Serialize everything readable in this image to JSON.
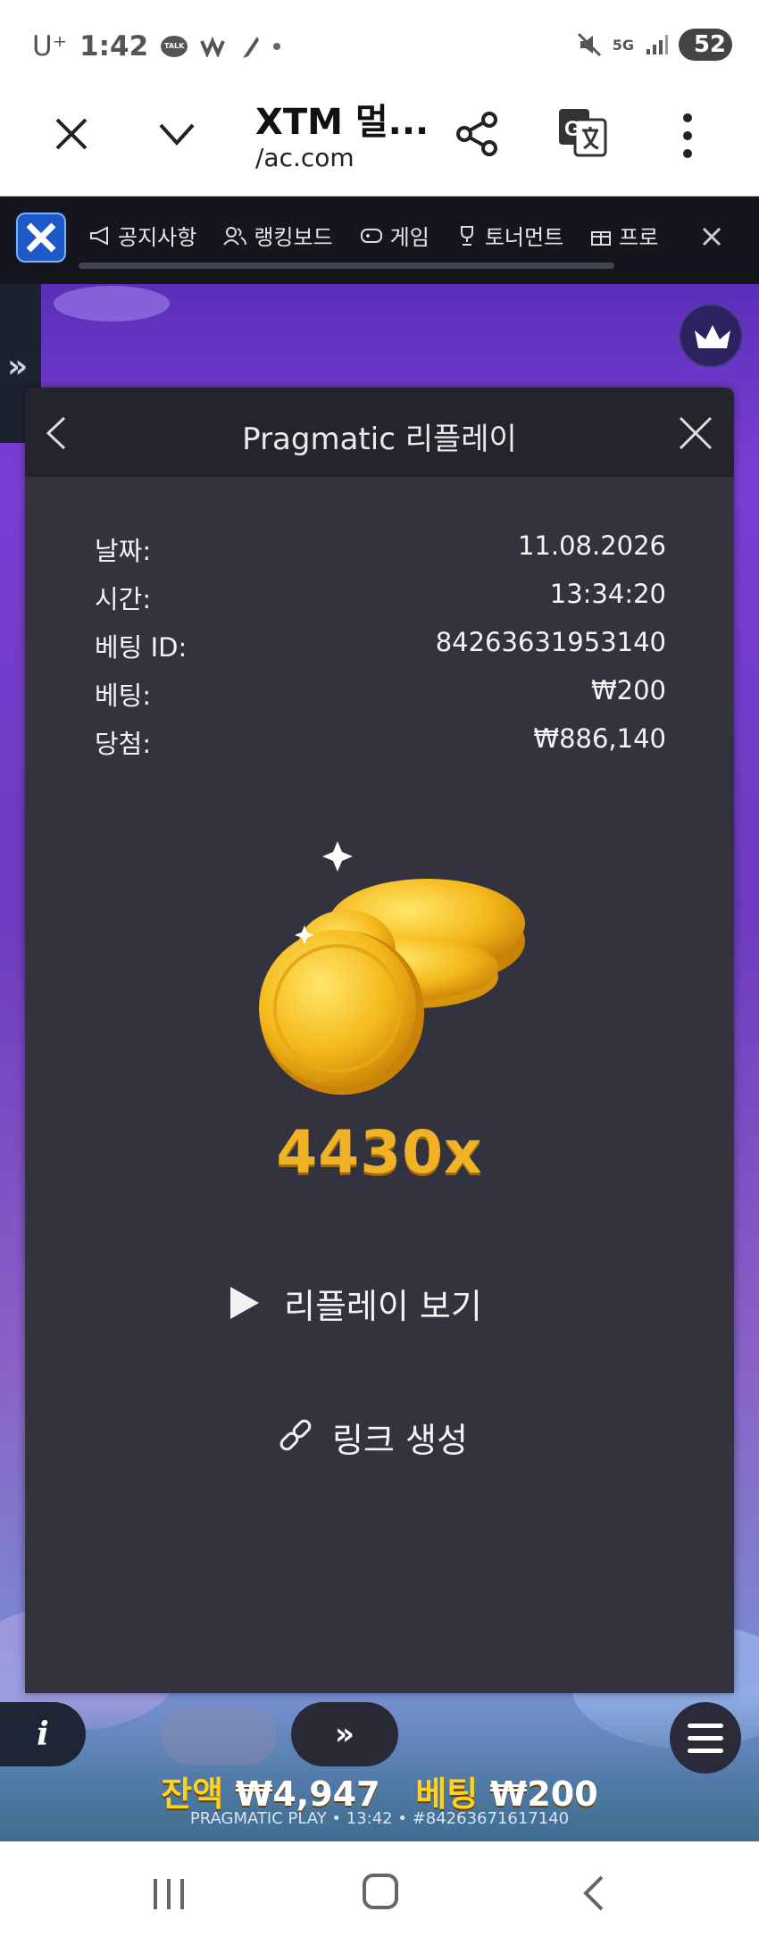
{
  "status_bar": {
    "carrier": "U⁺",
    "time": "1:42",
    "talk_badge": "TALK",
    "network": "5G",
    "battery": "52"
  },
  "browser": {
    "title": "XTM 멀...",
    "url": "/ac.com"
  },
  "site_nav": {
    "items": [
      "공지사항",
      "랭킹보드",
      "게임",
      "토너먼트",
      "프로"
    ]
  },
  "side_tab": {
    "label": "»"
  },
  "modal": {
    "title": "Pragmatic 리플레이",
    "info": [
      {
        "label": "날짜:",
        "value": "11.08.2026"
      },
      {
        "label": "시간:",
        "value": "13:34:20"
      },
      {
        "label": "베팅 ID:",
        "value": "84263631953140"
      },
      {
        "label": "베팅:",
        "value": "₩200"
      },
      {
        "label": "당첨:",
        "value": "₩886,140"
      }
    ],
    "multiplier": "4430x",
    "replay_label": "리플레이 보기",
    "link_label": "링크 생성"
  },
  "game_bar": {
    "info_label": "i",
    "spin_label": "»",
    "balance_label": "잔액",
    "balance_value": "₩4,947",
    "bet_label": "베팅",
    "bet_value": "₩200",
    "footer": "PRAGMATIC PLAY • 13:42 • #84263671617140"
  },
  "colors": {
    "modal_bg": "#33333f",
    "accent_gold": "#f0b226",
    "nav_bg": "#15161d"
  }
}
